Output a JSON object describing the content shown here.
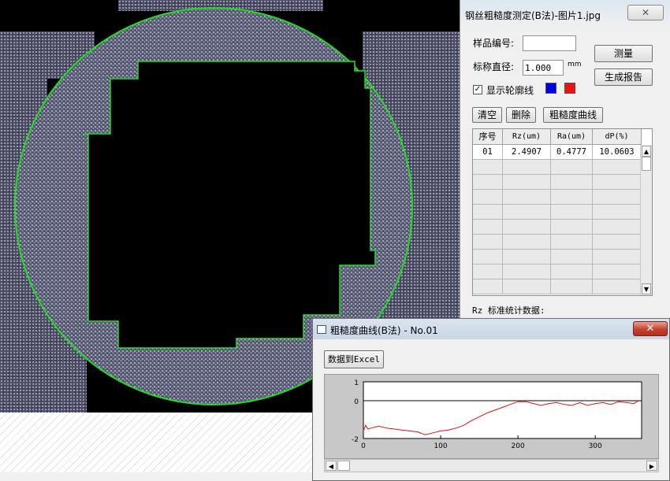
{
  "measure_window": {
    "title": "钢丝粗糙度测定(B法)-图片1.jpg",
    "close_glyph": "✕",
    "sample_no_label": "样品编号:",
    "sample_no_value": "",
    "diameter_label": "标称直径:",
    "diameter_value": "1.000",
    "diameter_unit": "mm",
    "measure_button": "测量",
    "report_button": "生成报告",
    "show_contour_label": "显示轮廓线",
    "show_contour_checked": true,
    "contour_colors": [
      "#0000ee",
      "#ee1111"
    ],
    "clear_button": "清空",
    "delete_button": "删除",
    "curve_button": "粗糙度曲线",
    "table": {
      "headers": [
        "序号",
        "Rz(um)",
        "Ra(um)",
        "dP(%)"
      ],
      "rows": [
        [
          "01",
          "2.4907",
          "0.4777",
          "10.0603"
        ]
      ],
      "empty_rows": 9
    },
    "stats_line": "Rz 标准统计数据:"
  },
  "curve_window": {
    "title": "粗糙度曲线(B法) - No.01",
    "close_glyph": "✕",
    "export_button": "数据到Excel",
    "left_arrow": "◀",
    "right_arrow": "▶"
  },
  "chart_data": {
    "type": "line",
    "title": "",
    "xlabel": "",
    "ylabel": "",
    "xlim": [
      0,
      360
    ],
    "ylim": [
      -2,
      1
    ],
    "x_ticks": [
      0,
      100,
      200,
      300
    ],
    "y_ticks": [
      1,
      0,
      -2
    ],
    "series": [
      {
        "color": "#e01010",
        "x": [
          0,
          3,
          6,
          10,
          20,
          30,
          40,
          50,
          60,
          70,
          80,
          90,
          100,
          110,
          120,
          130,
          140,
          150,
          160,
          170,
          180,
          190,
          200,
          210,
          220,
          230,
          240,
          250,
          260,
          270,
          280,
          290,
          300,
          310,
          320,
          330,
          340,
          350,
          356
        ],
        "y": [
          -1.6,
          -1.3,
          -1.5,
          -1.45,
          -1.35,
          -1.45,
          -1.5,
          -1.55,
          -1.6,
          -1.65,
          -1.8,
          -1.7,
          -1.6,
          -1.55,
          -1.45,
          -1.3,
          -1.05,
          -0.85,
          -0.65,
          -0.5,
          -0.35,
          -0.2,
          -0.05,
          -0.05,
          -0.15,
          -0.25,
          -0.15,
          -0.1,
          -0.2,
          -0.25,
          -0.1,
          -0.25,
          -0.15,
          -0.1,
          -0.2,
          -0.05,
          -0.1,
          -0.15,
          0.0
        ]
      }
    ]
  }
}
